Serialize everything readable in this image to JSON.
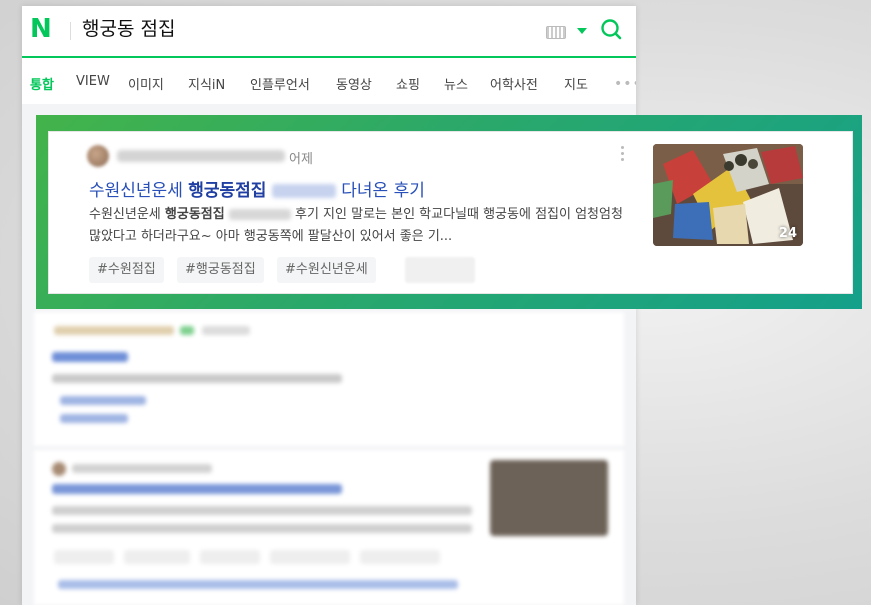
{
  "search": {
    "logo": "N",
    "query": "행궁동 점집"
  },
  "tabs": [
    "통합",
    "VIEW",
    "이미지",
    "지식iN",
    "인플루언서",
    "동영상",
    "쇼핑",
    "뉴스",
    "어학사전",
    "지도"
  ],
  "active_tab": "통합",
  "result": {
    "date": "어제",
    "title_prefix": "수원신년운세 ",
    "title_bold": "행궁동점집",
    "title_suffix": "다녀온 후기",
    "snippet_prefix": "수원신년운세 ",
    "snippet_bold": "행궁동점집",
    "snippet_rest": "후기 지인 말로는 본인 학교다닐때 행궁동에 점집이 엄청엄청 많았다고 하더라구요~ 아마 행궁동쪽에 팔달산이 있어서 좋은 기...",
    "tags": [
      "#수원점집",
      "#행궁동점집",
      "#수원신년운세"
    ],
    "image_count": "24"
  },
  "colors": {
    "brand": "#03c75a",
    "link": "#2850b8",
    "frame": "#2aa86b"
  }
}
